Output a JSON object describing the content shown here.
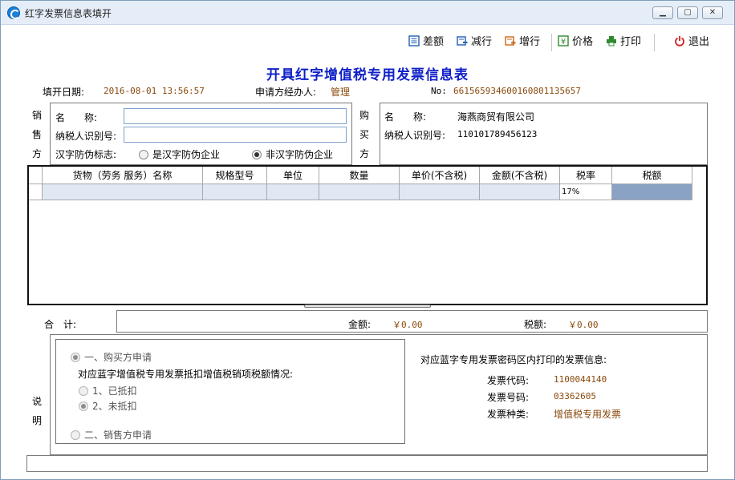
{
  "window": {
    "title": "红字发票信息表填开"
  },
  "toolbar": {
    "items": [
      {
        "label": "差额",
        "icon": "list-icon",
        "color": "#1f5fb5"
      },
      {
        "label": "减行",
        "icon": "remove-row-icon",
        "color": "#1f5fb5"
      },
      {
        "label": "增行",
        "icon": "add-row-icon",
        "color": "#c96a1a"
      },
      {
        "label": "价格",
        "icon": "yuan-icon",
        "color": "#2d8a2d"
      },
      {
        "label": "打印",
        "icon": "printer-icon",
        "color": "#2d8a2d"
      },
      {
        "label": "退出",
        "icon": "power-icon",
        "color": "#d02020"
      }
    ]
  },
  "form": {
    "title": "开具红字增值税专用发票信息表",
    "date_label": "填开日期:",
    "date_value": "2016-08-01 13:56:57",
    "applicant_label": "申请方经办人:",
    "applicant_value": "管理",
    "no_label": "No:",
    "no_value": "661565934600160801135657"
  },
  "seller": {
    "side_label": [
      "销",
      "售",
      "方"
    ],
    "name_label": "名　　称:",
    "name_value": "",
    "taxid_label": "纳税人识别号:",
    "taxid_value": "",
    "antifake_label": "汉字防伪标志:",
    "antifake_options": [
      "是汉字防伪企业",
      "非汉字防伪企业"
    ],
    "antifake_selected": 1
  },
  "buyer": {
    "side_label": [
      "购",
      "买",
      "方"
    ],
    "name_label": "名　　称:",
    "name_value": "海燕商贸有限公司",
    "taxid_label": "纳税人识别号:",
    "taxid_value": "110101789456123"
  },
  "items_table": {
    "columns": [
      "货物（劳务 服务）名称",
      "规格型号",
      "单位",
      "数量",
      "单价(不含税)",
      "金额(不含税)",
      "税率",
      "税额"
    ],
    "rows": [
      [
        "",
        "",
        "",
        "",
        "",
        "",
        "17%",
        ""
      ]
    ]
  },
  "totals": {
    "label": "合　计:",
    "amount_label": "金额:",
    "amount_value": "￥0.00",
    "tax_label": "税额:",
    "tax_value": "￥0.00"
  },
  "explain": {
    "side_label": [
      "说",
      "明"
    ],
    "option1": "一、购买方申请",
    "deduct_question": "对应蓝字增值税专用发票抵扣增值税销项税额情况:",
    "sub1": "1、已抵扣",
    "sub2": "2、未抵扣",
    "option2": "二、销售方申请",
    "blue_title": "对应蓝字专用发票密码区内打印的发票信息:",
    "code_label": "发票代码:",
    "code_value": "1100044140",
    "number_label": "发票号码:",
    "number_value": "03362605",
    "type_label": "发票种类:",
    "type_value": "增值税专用发票"
  }
}
